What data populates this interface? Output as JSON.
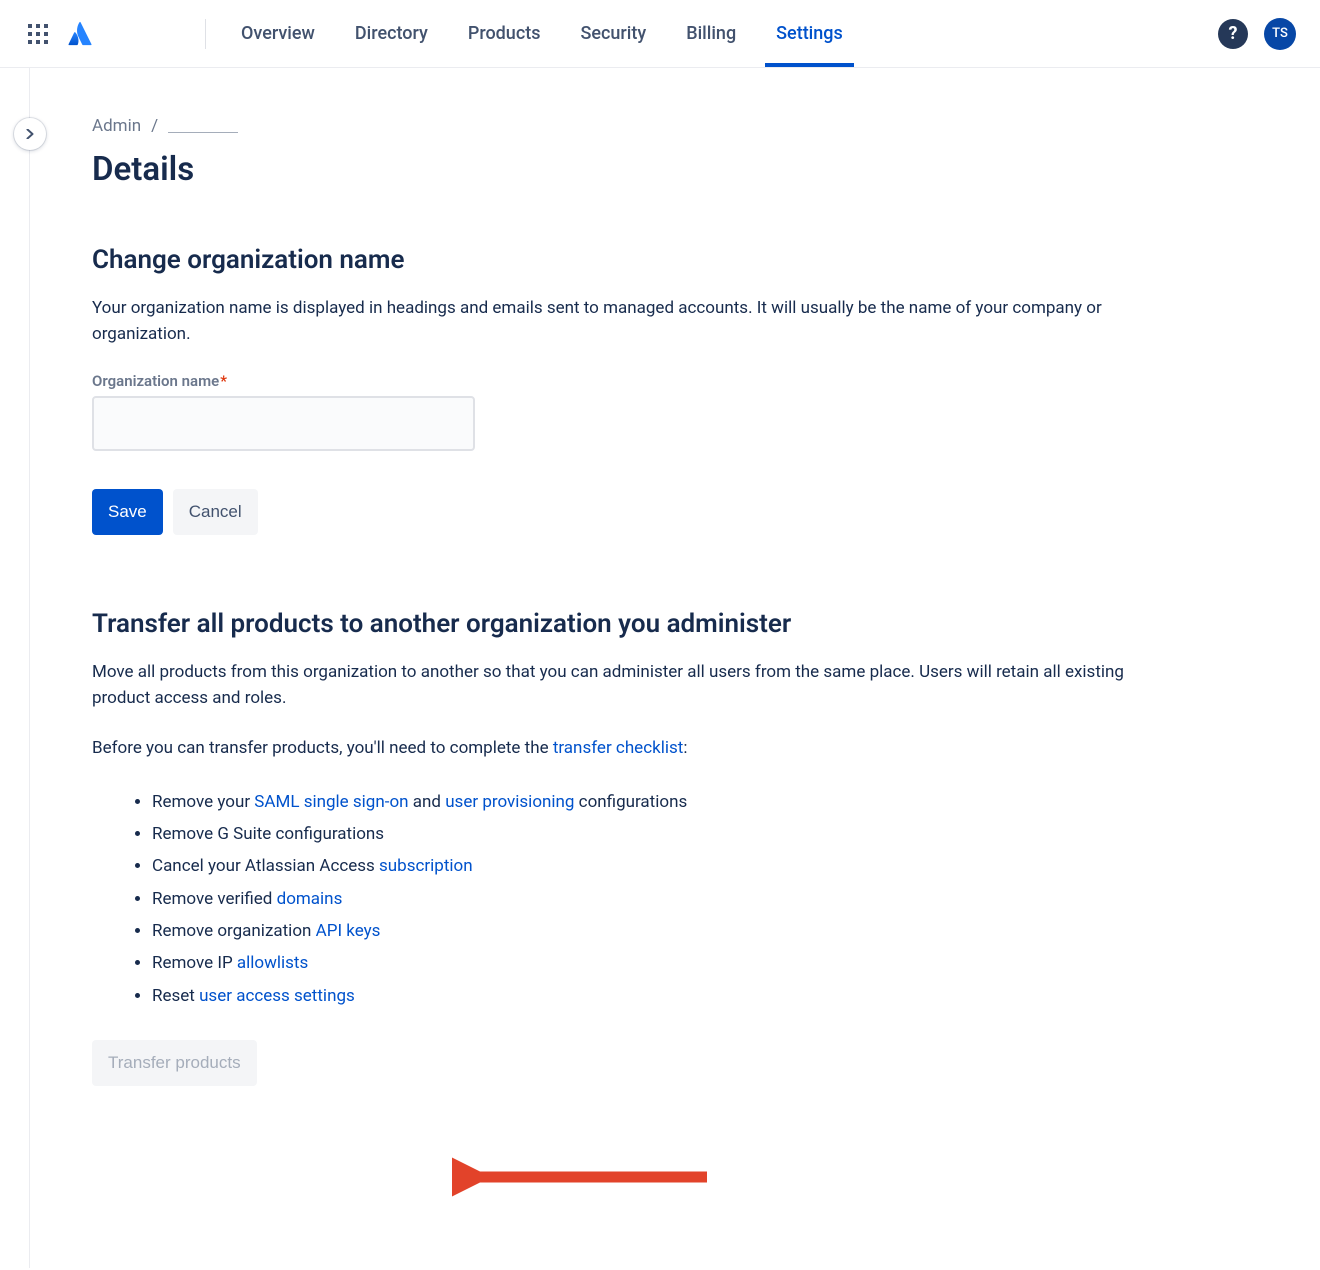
{
  "header": {
    "nav": [
      {
        "label": "Overview",
        "active": false
      },
      {
        "label": "Directory",
        "active": false
      },
      {
        "label": "Products",
        "active": false
      },
      {
        "label": "Security",
        "active": false
      },
      {
        "label": "Billing",
        "active": false
      },
      {
        "label": "Settings",
        "active": true
      }
    ],
    "help_symbol": "?",
    "avatar_initials": "TS"
  },
  "breadcrumb": {
    "root": "Admin",
    "sep": "/"
  },
  "page": {
    "title": "Details"
  },
  "section_org": {
    "heading": "Change organization name",
    "desc": "Your organization name is displayed in headings and emails sent to managed accounts. It will usually be the name of your company or organization.",
    "field_label": "Organization name",
    "required_mark": "*",
    "field_value": "",
    "save_label": "Save",
    "cancel_label": "Cancel"
  },
  "section_transfer": {
    "heading": "Transfer all products to another organization you administer",
    "desc1": "Move all products from this organization to another so that you can administer all users from the same place. Users will retain all existing product access and roles.",
    "desc2_pre": "Before you can transfer products, you'll need to complete the ",
    "desc2_link": "transfer checklist",
    "desc2_post": ":",
    "items": [
      {
        "pre": "Remove your ",
        "link1": "SAML single sign-on",
        "mid": " and ",
        "link2": "user provisioning",
        "post": " configurations"
      },
      {
        "pre": "Remove G Suite configurations"
      },
      {
        "pre": "Cancel your Atlassian Access ",
        "link1": "subscription"
      },
      {
        "pre": "Remove verified ",
        "link1": "domains"
      },
      {
        "pre": "Remove organization ",
        "link1": "API keys"
      },
      {
        "pre": "Remove IP ",
        "link1": "allowlists"
      },
      {
        "pre": "Reset ",
        "link1": "user access settings"
      }
    ],
    "transfer_button": "Transfer products"
  }
}
